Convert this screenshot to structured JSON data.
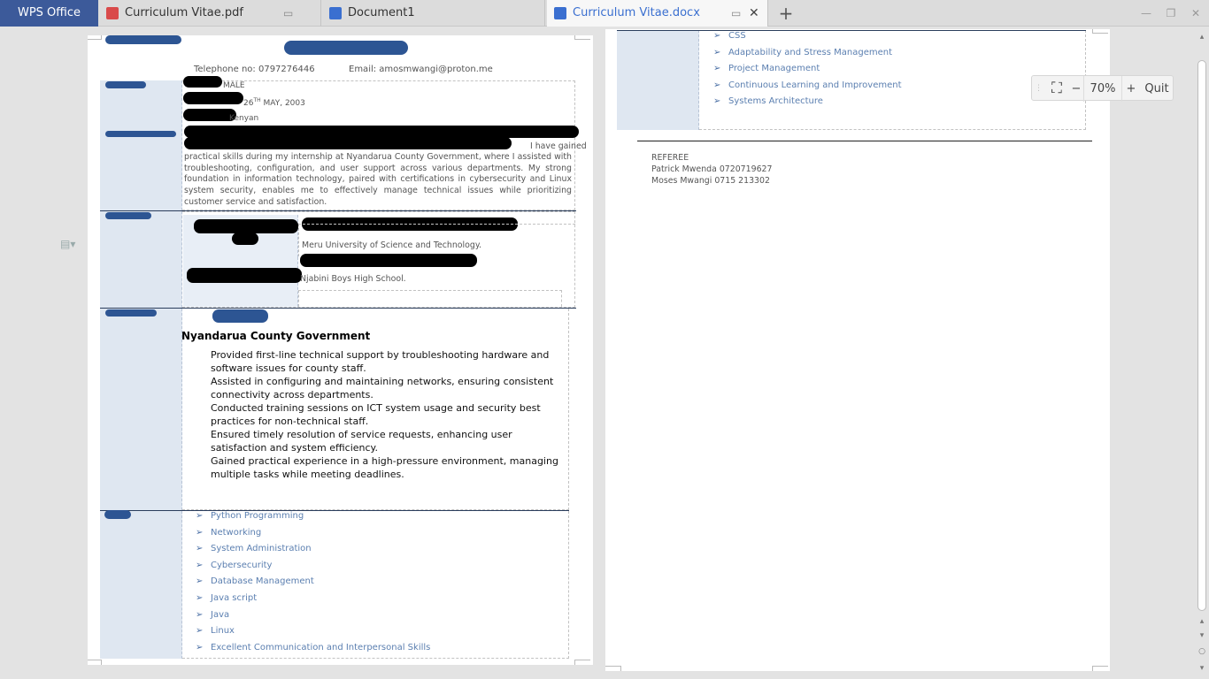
{
  "tabs": {
    "home": "WPS Office",
    "pdf": "Curriculum Vitae.pdf",
    "doc1": "Document1",
    "active": "Curriculum Vitae.docx"
  },
  "zoom": {
    "level": "70%",
    "minus": "−",
    "plus": "+",
    "quit": "Quit"
  },
  "page1": {
    "telephone": "Telephone no:  0797276446",
    "email": "Email:  amosmwangi@proton.me",
    "gender": "MALE",
    "dob_day": "26",
    "dob_suffix": "TH",
    "dob_rest": "MAY, 2003",
    "nationality_tail": "Kenyan",
    "profile_tail": "I have gained",
    "profile_text": "practical skills during my internship at Nyandarua County Government, where I assisted with troubleshooting, configuration, and user support across various departments. My strong foundation in information technology, paired with certifications in cybersecurity and Linux system security, enables me to effectively manage technical issues while prioritizing customer service and satisfaction.",
    "edu1_school": "Meru University of Science and Technology.",
    "edu2_school": "Njabini Boys High School.",
    "exp_org": "Nyandarua County Government",
    "exp_items": [
      "Provided first-line technical support by troubleshooting hardware and software issues for county staff.",
      "Assisted in configuring and maintaining networks, ensuring consistent connectivity across departments.",
      "Conducted training sessions on ICT system usage and security best practices for non-technical staff.",
      "Ensured timely resolution of service requests, enhancing user satisfaction and system efficiency.",
      "Gained practical experience in a high-pressure environment, managing multiple tasks while meeting deadlines."
    ],
    "skills": [
      "Python Programming",
      "Networking",
      "System Administration",
      "Cybersecurity",
      "Database Management",
      "Java script",
      "Java",
      "Linux",
      "Excellent Communication and Interpersonal Skills"
    ]
  },
  "page2": {
    "skills": [
      "CSS",
      "Adaptability and Stress Management",
      "Project Management",
      "Continuous Learning and Improvement",
      "Systems Architecture"
    ],
    "referee_heading": "REFEREE",
    "referees": [
      "Patrick Mwenda 0720719627",
      "Moses Mwangi  0715 213302"
    ]
  },
  "icons": {
    "arrow": "➢",
    "pdf": "pdf-icon",
    "writer": "writer-icon"
  },
  "colors": {
    "home_tab": "#3c5a9a",
    "active_tab_text": "#3a6fd0",
    "label_column": "#dfe7f1",
    "skill_text": "#5b7fb0",
    "heading_blue": "#2d5593"
  }
}
